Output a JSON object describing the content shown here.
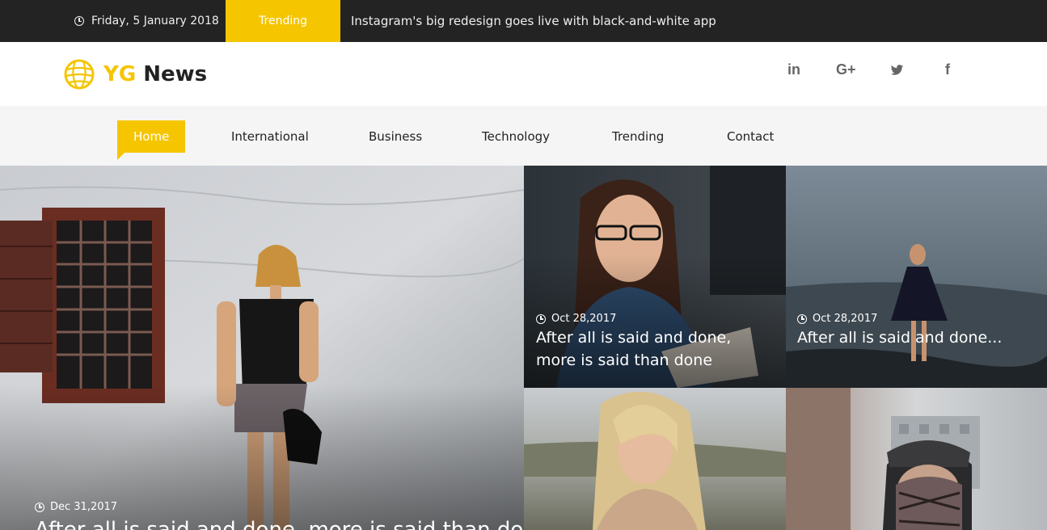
{
  "topbar": {
    "date": "Friday, 5 January 2018",
    "trending_label": "Trending",
    "headline": "Instagram's big redesign goes live with black-and-white app"
  },
  "brand": {
    "name_part1": "YG",
    "name_part2": "News",
    "accent_color": "#f5c500"
  },
  "socials": [
    {
      "icon": "linkedin-icon",
      "glyph": "in"
    },
    {
      "icon": "google-plus-icon",
      "glyph": "G+"
    },
    {
      "icon": "twitter-icon",
      "glyph": "🐦"
    },
    {
      "icon": "facebook-icon",
      "glyph": "f"
    }
  ],
  "nav": {
    "items": [
      {
        "label": "Home",
        "active": true
      },
      {
        "label": "International"
      },
      {
        "label": "Business"
      },
      {
        "label": "Technology"
      },
      {
        "label": "Trending"
      },
      {
        "label": "Contact"
      }
    ]
  },
  "articles": [
    {
      "date": "Dec 31,2017",
      "title": "After all is said and done, more is said than done"
    },
    {
      "date": "Oct 28,2017",
      "title": "After all is said and done, more is said than done"
    },
    {
      "date": "Oct 28,2017",
      "title": "After all is said and done..."
    },
    {
      "date": "",
      "title": ""
    },
    {
      "date": "",
      "title": ""
    }
  ]
}
